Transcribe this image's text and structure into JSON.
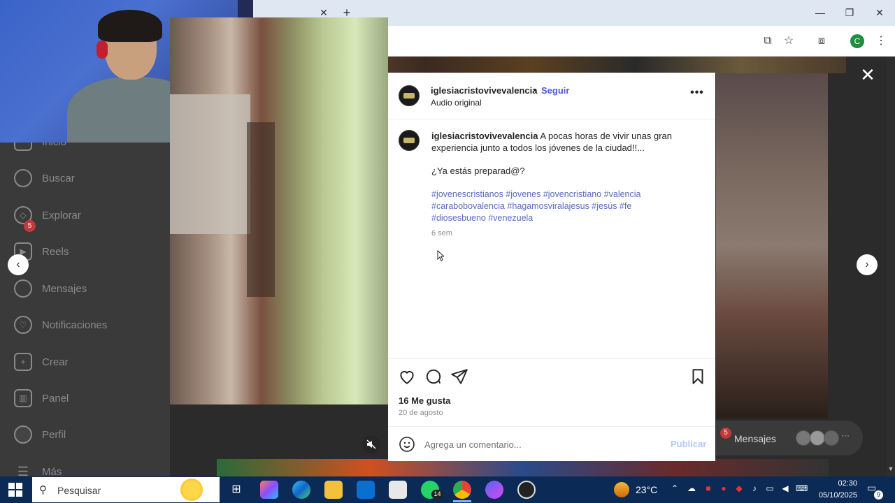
{
  "browser": {
    "tab_close": "✕",
    "new_tab": "+",
    "profile_initial": "C",
    "window_controls": {
      "minimize": "—",
      "maximize": "❐",
      "close": "✕"
    }
  },
  "sidebar": {
    "items": [
      {
        "label": "Inicio",
        "icon": "home-icon"
      },
      {
        "label": "Buscar",
        "icon": "search-icon"
      },
      {
        "label": "Explorar",
        "icon": "compass-icon"
      },
      {
        "label": "Reels",
        "icon": "reels-icon"
      },
      {
        "label": "Mensajes",
        "icon": "messenger-icon",
        "badge": "5"
      },
      {
        "label": "Notificaciones",
        "icon": "heart-icon"
      },
      {
        "label": "Crear",
        "icon": "plus-square-icon"
      },
      {
        "label": "Panel",
        "icon": "chart-icon"
      },
      {
        "label": "Perfil",
        "icon": "avatar-icon"
      },
      {
        "label": "Más",
        "icon": "menu-icon"
      }
    ]
  },
  "post": {
    "username": "iglesiacristovivevalencia",
    "separator": "•",
    "follow": "Seguir",
    "audio": "Audio original",
    "more": "•••",
    "caption": "A pocas horas de vivir unas gran experiencia junto a todos los jóvenes de la ciudad!!...",
    "question": "¿Ya estás preparad@?",
    "hashtags": "#jovenescristianos #jovenes #jovencristiano #valencia #carabobovalencia #hagamosviralajesus #jesús #fe #diosesbueno #venezuela",
    "caption_time": "6 sem",
    "likes": "16 Me gusta",
    "date": "20 de agosto",
    "comment_placeholder": "Agrega un comentario...",
    "publish": "Publicar"
  },
  "modal": {
    "close": "✕",
    "prev": "‹",
    "next": "›"
  },
  "messages_bar": {
    "badge": "5",
    "label": "Mensajes",
    "more": "···"
  },
  "taskbar": {
    "search_label": "Pesquisar",
    "whatsapp_badge": "14",
    "temperature": "23°C",
    "time": "02:30",
    "date": "05/10/2025",
    "notifications_badge": "9"
  },
  "colors": {
    "link": "#4f5bd5",
    "hashtag": "#5c6bc0",
    "taskbar": "#0b2a56",
    "badge": "#c2383b"
  }
}
